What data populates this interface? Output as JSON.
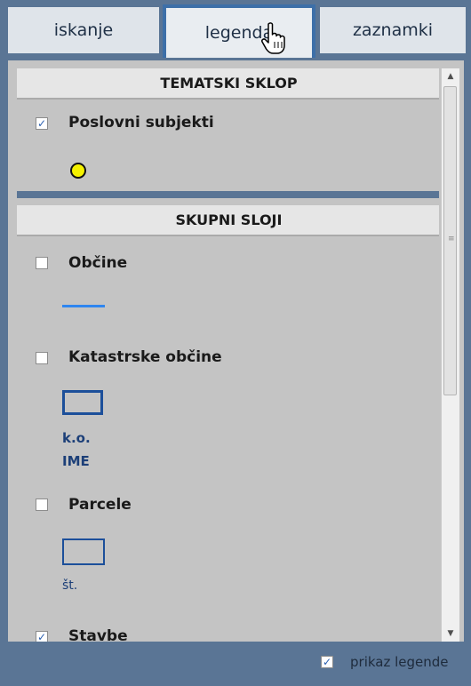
{
  "tabs": [
    {
      "label": "iskanje",
      "active": false
    },
    {
      "label": "legenda",
      "active": true
    },
    {
      "label": "zaznamki",
      "active": false
    }
  ],
  "sections": {
    "tematski": {
      "title": "TEMATSKI SKLOP",
      "layers": [
        {
          "label": "Poslovni subjekti",
          "checked": true,
          "symbol": "yellow-circle-icon"
        }
      ]
    },
    "skupni": {
      "title": "SKUPNI SLOJI",
      "layers": [
        {
          "label": "Občine",
          "checked": false,
          "symbol": "blue-line-icon"
        },
        {
          "label": "Katastrske občine",
          "checked": false,
          "symbol": "rectangle-icon",
          "sublabel_line1": "k.o.",
          "sublabel_line2": "IME"
        },
        {
          "label": "Parcele",
          "checked": false,
          "symbol": "rectangle-icon",
          "sublabel": "št."
        },
        {
          "label": "Stavbe",
          "checked": true
        }
      ]
    }
  },
  "footer": {
    "label": "prikaz legende",
    "checked": true
  },
  "colors": {
    "frame": "#5a7595",
    "active_tab_border": "#3d6fa8",
    "panel": "#c4c4c4",
    "symbol_blue": "#1c4f9a",
    "line_blue": "#2f86f0",
    "dot_yellow": "#f5f200"
  }
}
